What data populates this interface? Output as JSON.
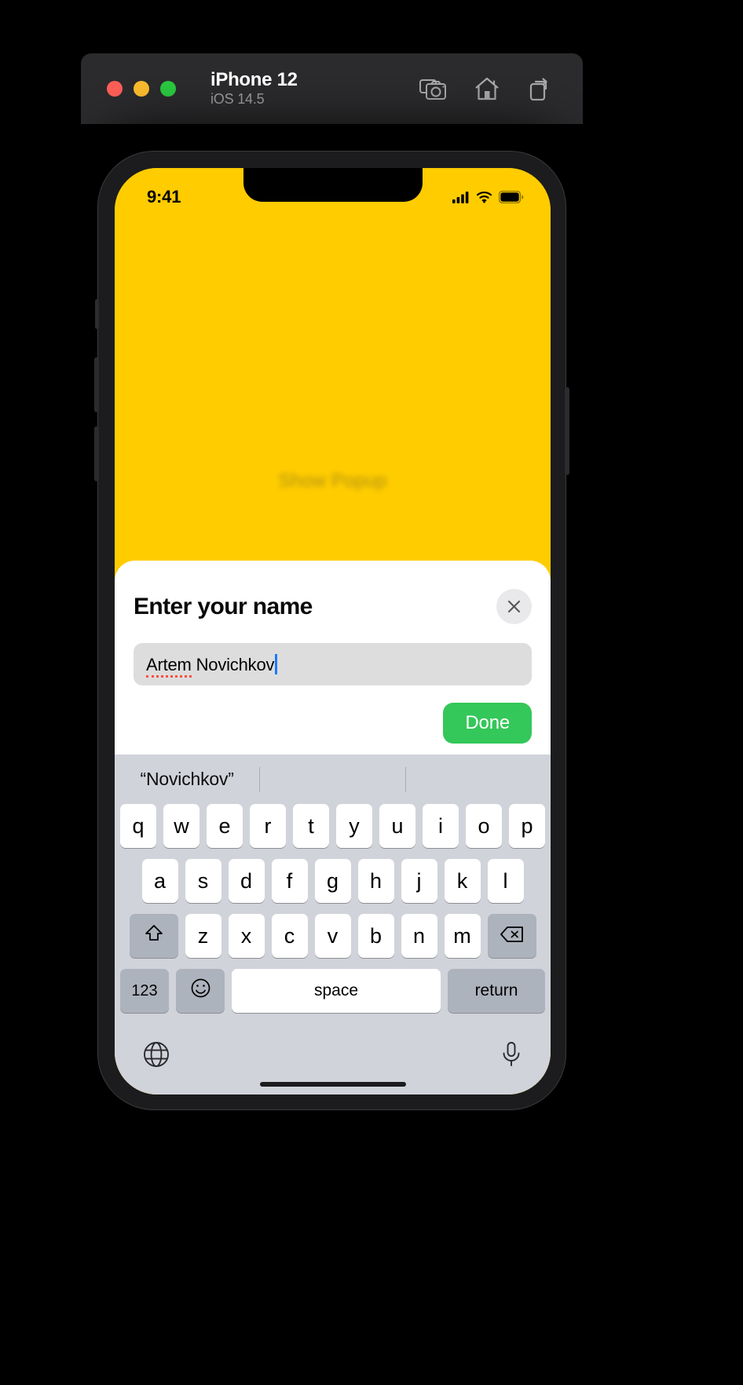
{
  "simulator": {
    "device_name": "iPhone 12",
    "os_version": "iOS 14.5",
    "window_controls": [
      {
        "name": "close",
        "color": "#fc5f57"
      },
      {
        "name": "minimize",
        "color": "#fdbc2e"
      },
      {
        "name": "zoom",
        "color": "#2bc940"
      }
    ],
    "actions": [
      {
        "name": "screenshot-icon",
        "label": "Screenshot"
      },
      {
        "name": "home-icon",
        "label": "Home"
      },
      {
        "name": "rotate-icon",
        "label": "Rotate"
      }
    ]
  },
  "status_bar": {
    "time": "9:41",
    "icons": [
      "cellular-signal",
      "wifi",
      "battery"
    ]
  },
  "app": {
    "background_color": "#FFCC00",
    "show_popup_label": "Show Popup"
  },
  "popup": {
    "title": "Enter your name",
    "close_label": "×",
    "text_field": {
      "value": "Artem Novichkov",
      "misspelled_word": "Artem",
      "rest_value": " Novichkov",
      "placeholder": "Enter your name"
    },
    "done_label": "Done"
  },
  "keyboard": {
    "suggestions": [
      "“Novichkov”",
      "",
      ""
    ],
    "rows": [
      [
        "q",
        "w",
        "e",
        "r",
        "t",
        "y",
        "u",
        "i",
        "o",
        "p"
      ],
      [
        "a",
        "s",
        "d",
        "f",
        "g",
        "h",
        "j",
        "k",
        "l"
      ],
      [
        "z",
        "x",
        "c",
        "v",
        "b",
        "n",
        "m"
      ]
    ],
    "shift_label": "shift",
    "backspace_label": "delete",
    "numeric_label": "123",
    "emoji_label": "emoji",
    "space_label": "space",
    "return_label": "return",
    "globe_label": "globe",
    "dictation_label": "dictation"
  },
  "colors": {
    "accent_yellow": "#FFCC00",
    "done_green": "#34C759",
    "keyboard_bg": "#D1D3DA",
    "key_bg": "#FFFFFF",
    "modifier_key_bg": "#ADB3BD",
    "field_bg": "#DDDDDD",
    "caret_blue": "#1A7BFF",
    "spellcheck_red": "#FF4F3F"
  }
}
